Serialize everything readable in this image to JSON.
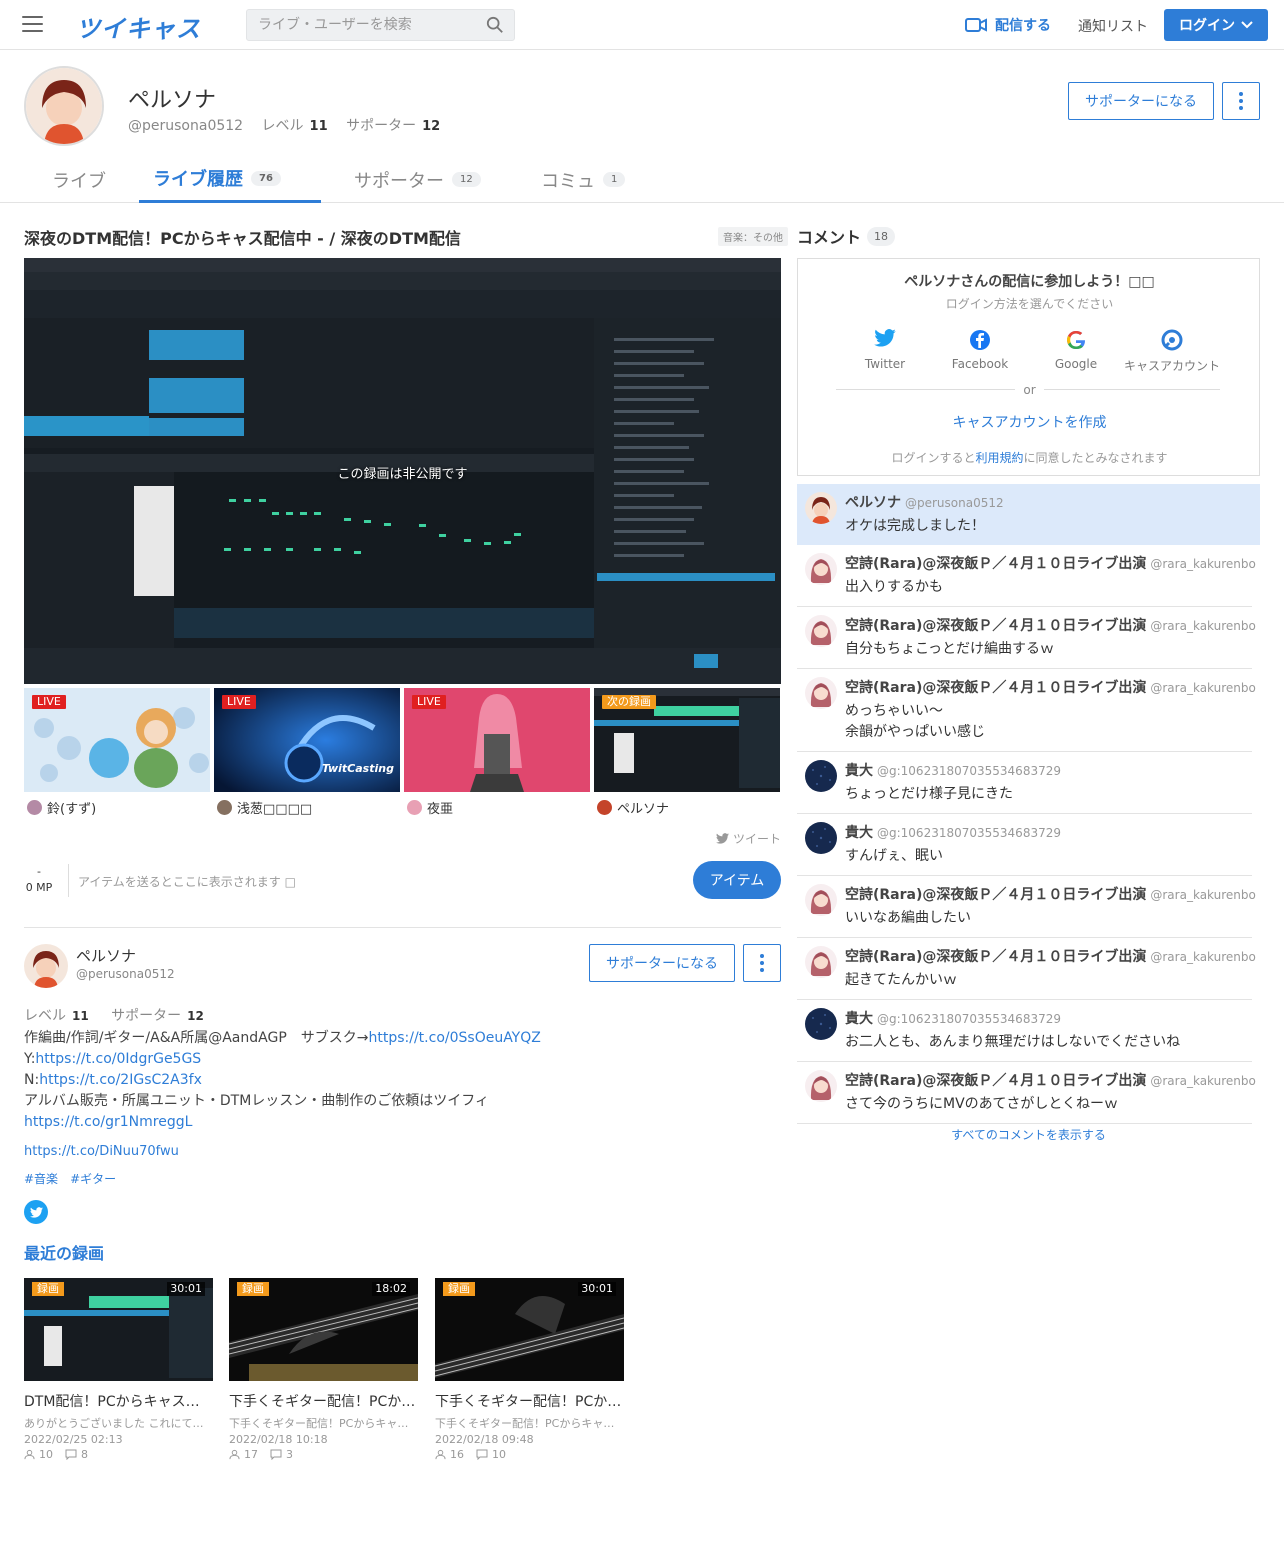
{
  "header": {
    "logo": "ツイキャス",
    "search_placeholder": "ライブ・ユーザーを検索",
    "broadcast_label": "配信する",
    "notify_label": "通知リスト",
    "login_label": "ログイン"
  },
  "profile": {
    "name": "ペルソナ",
    "id": "@perusona0512",
    "level_label": "レベル",
    "level": "11",
    "supporter_label": "サポーター",
    "supporters": "12",
    "supporter_button": "サポーターになる"
  },
  "tabs": [
    {
      "label": "ライブ",
      "count": ""
    },
    {
      "label": "ライブ履歴",
      "count": "76"
    },
    {
      "label": "サポーター",
      "count": "12"
    },
    {
      "label": "コミュ",
      "count": "1"
    }
  ],
  "movie": {
    "title": "深夜のDTM配信！PCからキャス配信中 - / 深夜のDTM配信",
    "genre": "音楽：その他",
    "private_message": "この録画は非公開です"
  },
  "thumbs": [
    {
      "badge": "LIVE",
      "name": "鈴(すず)",
      "color": "#cfe3f3"
    },
    {
      "badge": "LIVE",
      "name": "浅葱□□□□",
      "color": "#0d2a5c"
    },
    {
      "badge": "LIVE",
      "name": "夜亜",
      "color": "#e2496f"
    },
    {
      "badge": "次の録画",
      "name": "ペルソナ",
      "color": "#161b20"
    }
  ],
  "tweet_label": "ツイート",
  "items": {
    "mp_top": "-",
    "mp_value": "0 MP",
    "hint": "アイテムを送るとここに表示されます □",
    "button": "アイテム"
  },
  "owner": {
    "name": "ペルソナ",
    "id": "@perusona0512",
    "supporter_button": "サポーターになる",
    "level_label": "レベル",
    "level": "11",
    "supporter_label": "サポーター",
    "supporters": "12",
    "bio_line1_text": "作編曲/作詞/ギター/A&A所属@AandAGP　サブスク→",
    "bio_line1_link": "https://t.co/0SsOeuAYQZ",
    "bio_line2_text": "Y:",
    "bio_line2_link": "https://t.co/0IdgrGe5GS",
    "bio_line3_text": "N:",
    "bio_line3_link": "https://t.co/2IGsC2A3fx",
    "bio_line4_text": "アルバム販売・所属ユニット・DTMレッスン・曲制作のご依頼はツイフィ",
    "bio_line5_link": "https://t.co/gr1NmreggL",
    "extra_link": "https://t.co/DiNuu70fwu",
    "hashtags": [
      "#音楽",
      "#ギター"
    ]
  },
  "recent": {
    "title": "最近の録画",
    "items": [
      {
        "badge": "録画",
        "duration": "30:01",
        "title": "DTM配信！PCからキャス配信中 -",
        "desc": "ありがとうございました これにて終了です",
        "date": "2022/02/25 02:13",
        "views": "10",
        "comments": "8"
      },
      {
        "badge": "録画",
        "duration": "18:02",
        "title": "下手くそギター配信！PCからキャス配信中",
        "desc": "下手くそギター配信！PCからキャス配信中",
        "date": "2022/02/18 10:18",
        "views": "17",
        "comments": "3"
      },
      {
        "badge": "録画",
        "duration": "30:01",
        "title": "下手くそギター配信！PCからキャス配信中",
        "desc": "下手くそギター配信！PCからキャス配信中",
        "date": "2022/02/18 09:48",
        "views": "16",
        "comments": "10"
      }
    ]
  },
  "comments_panel": {
    "title": "コメント",
    "count": "18",
    "login_title": "ペルソナさんの配信に参加しよう！□□",
    "login_sub": "ログイン方法を選んでください",
    "sns": [
      "Twitter",
      "Facebook",
      "Google",
      "キャスアカウント"
    ],
    "or": "or",
    "create": "キャスアカウントを作成",
    "note_pre": "ログインすると",
    "note_link": "利用規約",
    "note_post": "に同意したとみなされます",
    "show_all": "すべてのコメントを表示する"
  },
  "comments": [
    {
      "name": "ペルソナ",
      "id": "@perusona0512",
      "text": "オケは完成しました！",
      "av": "persona",
      "highlight": true
    },
    {
      "name": "空詩(Rara)@深夜飯Ｐ／４月１０日ライブ出演",
      "id": "@rara_kakurenbo",
      "text": "出入りするかも",
      "av": "rara"
    },
    {
      "name": "空詩(Rara)@深夜飯Ｐ／４月１０日ライブ出演",
      "id": "@rara_kakurenbo",
      "text": "自分もちょこっとだけ編曲するｗ",
      "av": "rara"
    },
    {
      "name": "空詩(Rara)@深夜飯Ｐ／４月１０日ライブ出演",
      "id": "@rara_kakurenbo",
      "text": "めっちゃいい～",
      "text2": "余韻がやっぱいい感じ",
      "av": "rara"
    },
    {
      "name": "貴大",
      "id": "@g:106231807035534683729",
      "text": "ちょっとだけ様子見にきた",
      "av": "taka"
    },
    {
      "name": "貴大",
      "id": "@g:106231807035534683729",
      "text": "すんげぇ、眠い",
      "av": "taka"
    },
    {
      "name": "空詩(Rara)@深夜飯Ｐ／４月１０日ライブ出演",
      "id": "@rara_kakurenbo",
      "text": "いいなあ編曲したい",
      "av": "rara"
    },
    {
      "name": "空詩(Rara)@深夜飯Ｐ／４月１０日ライブ出演",
      "id": "@rara_kakurenbo",
      "text": "起きてたんかいｗ",
      "av": "rara"
    },
    {
      "name": "貴大",
      "id": "@g:106231807035534683729",
      "text": "お二人とも、あんまり無理だけはしないでくださいね",
      "av": "taka"
    },
    {
      "name": "空詩(Rara)@深夜飯Ｐ／４月１０日ライブ出演",
      "id": "@rara_kakurenbo",
      "text": "さて今のうちにMVのあてさがしとくねーｗ",
      "av": "rara"
    }
  ]
}
